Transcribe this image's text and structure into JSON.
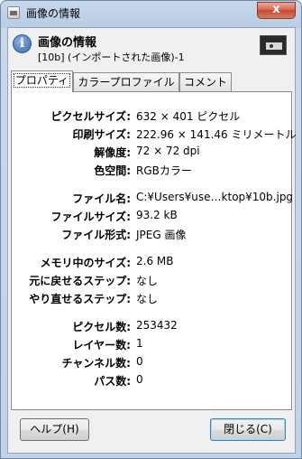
{
  "window": {
    "title": "画像の情報",
    "close_label": "x"
  },
  "header": {
    "title": "画像の情報",
    "subtitle": "[10b] (インポートされた画像)-1"
  },
  "tabs": [
    {
      "label": "プロパティ"
    },
    {
      "label": "カラープロファイル"
    },
    {
      "label": "コメント"
    }
  ],
  "properties": [
    {
      "label": "ピクセルサイズ:",
      "value": "632 × 401 ピクセル"
    },
    {
      "label": "印刷サイズ:",
      "value": "222.96 × 141.46 ミリメートル"
    },
    {
      "label": "解像度:",
      "value": "72 × 72 dpi"
    },
    {
      "label": "色空間:",
      "value": "RGBカラー"
    },
    {
      "label": "ファイル名:",
      "value": "C:¥Users¥use…ktop¥10b.jpg"
    },
    {
      "label": "ファイルサイズ:",
      "value": "93.2 kB"
    },
    {
      "label": "ファイル形式:",
      "value": "JPEG 画像"
    },
    {
      "label": "メモリ中のサイズ:",
      "value": "2.6 MB"
    },
    {
      "label": "元に戻せるステップ:",
      "value": "なし"
    },
    {
      "label": "やり直せるステップ:",
      "value": "なし"
    },
    {
      "label": "ピクセル数:",
      "value": "253432"
    },
    {
      "label": "レイヤー数:",
      "value": "1"
    },
    {
      "label": "チャンネル数:",
      "value": "0"
    },
    {
      "label": "パス数:",
      "value": "0"
    }
  ],
  "buttons": {
    "help": "ヘルプ(H)",
    "close": "閉じる(C)"
  }
}
